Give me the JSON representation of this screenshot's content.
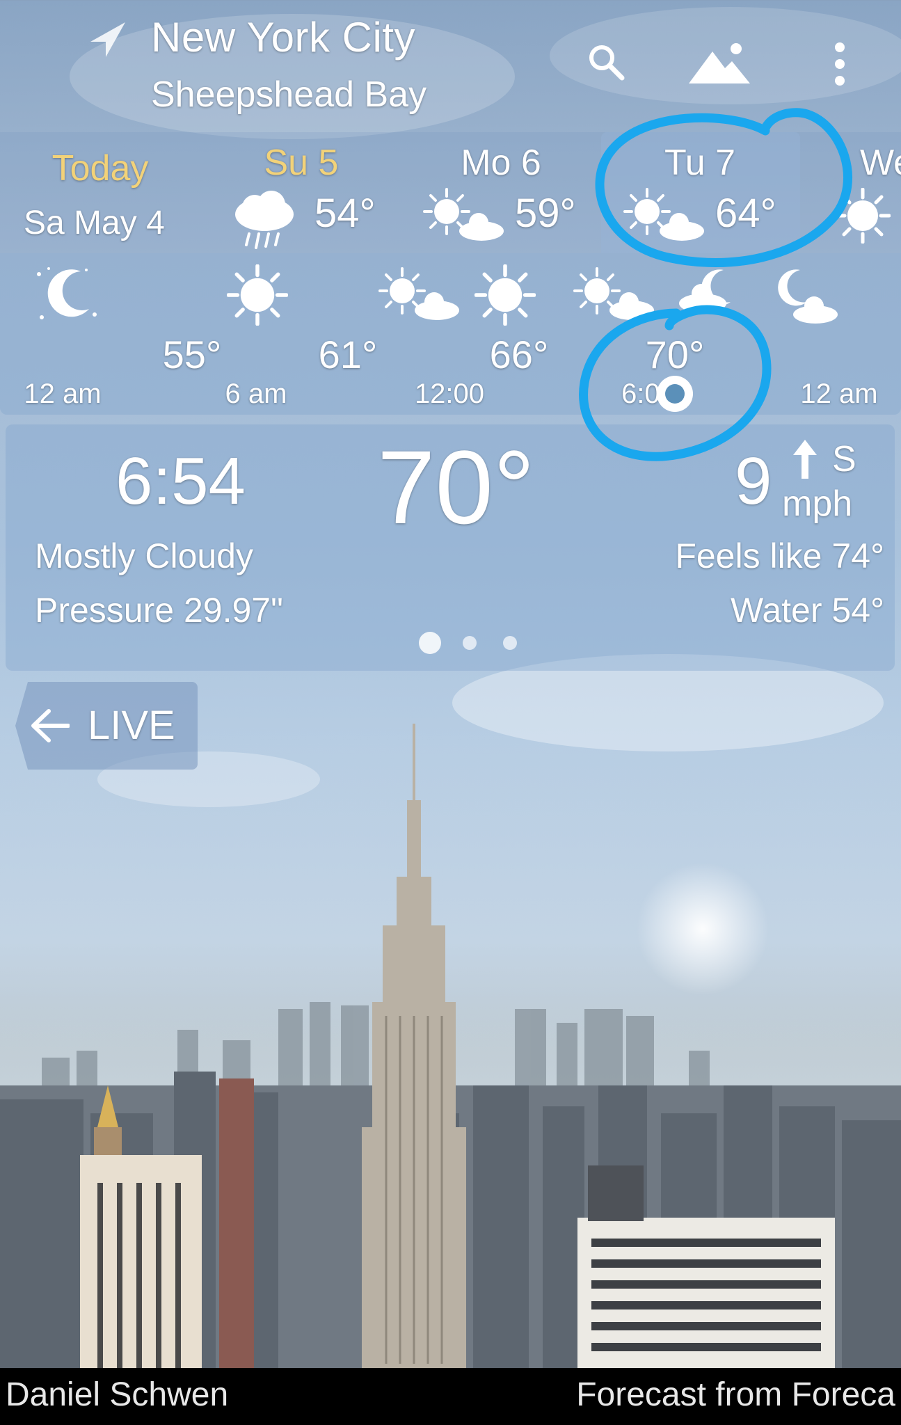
{
  "header": {
    "city": "New York City",
    "district": "Sheepshead Bay",
    "icons": [
      "location-arrow-icon",
      "search-icon",
      "landscape-icon",
      "more-vertical-icon"
    ]
  },
  "days": [
    {
      "name": "Today",
      "date": "Sa May 4",
      "icon": "none"
    },
    {
      "name": "Su 5",
      "temp": "54°",
      "icon": "rain-cloud-icon"
    },
    {
      "name": "Mo 6",
      "temp": "59°",
      "icon": "partly-sunny-icon"
    },
    {
      "name": "Tu 7",
      "temp": "64°",
      "icon": "partly-sunny-icon",
      "selected": true
    },
    {
      "name": "We",
      "icon": "sun-icon"
    }
  ],
  "hourly": {
    "temps": [
      "55°",
      "61°",
      "66°",
      "70°"
    ],
    "times": [
      "12 am",
      "6 am",
      "12:00",
      "6:00",
      "12 am"
    ],
    "icons": [
      "moon-stars-icon",
      "sun-icon",
      "partly-sunny-icon",
      "sun-icon",
      "partly-sunny-icon",
      "partly-cloudy-night-icon",
      "moon-cloud-icon"
    ]
  },
  "current": {
    "time": "6:54",
    "temp": "70°",
    "wind_speed": "9",
    "wind_unit": "mph",
    "wind_dir": "S",
    "condition": "Mostly Cloudy",
    "pressure": "Pressure 29.97\"",
    "feels_like": "Feels like 74°",
    "water": "Water 54°",
    "page_index": 1,
    "page_count": 3
  },
  "live_button": {
    "label": "LIVE"
  },
  "footer": {
    "credit": "Daniel Schwen",
    "source": "Forecast from Foreca"
  },
  "colors": {
    "today": "#f2d279",
    "annotation": "#1aa7ee"
  }
}
